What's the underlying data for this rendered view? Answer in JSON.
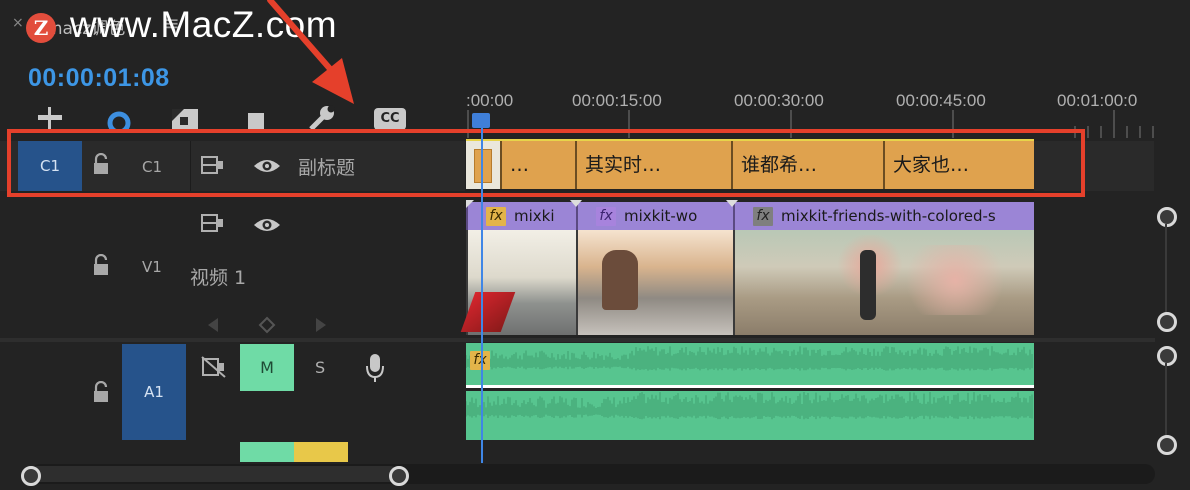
{
  "header": {
    "close_glyph": "×",
    "tab_title": "macz调色",
    "menu_glyph": "≡",
    "logo_letter": "Z",
    "watermark": "www.MacZ.com",
    "timecode": "00:00:01:08"
  },
  "toolbar": {
    "icons": [
      "snap-icon",
      "linked-selection-icon",
      "marker-icon",
      "add-marker-icon",
      "wrench-icon",
      "captions-icon"
    ],
    "captions_label": "CC"
  },
  "ruler": {
    "labels": [
      ":00:00",
      "00:00:15:00",
      "00:00:30:00",
      "00:00:45:00",
      "00:01:00:0"
    ]
  },
  "tracks": {
    "c1": {
      "source": "C1",
      "label": "C1",
      "name": "副标题"
    },
    "v1": {
      "label": "V1",
      "name": "视频 1"
    },
    "a1": {
      "source": "A1",
      "mute": "M",
      "solo": "S"
    }
  },
  "caption_clips": [
    "…",
    "其实时…",
    "谁都希…",
    "大家也…"
  ],
  "video_clips": [
    {
      "name": "mixki",
      "fx": "fx"
    },
    {
      "name": "mixkit-wo",
      "fx": "fx"
    },
    {
      "name": "mixkit-friends-with-colored-s",
      "fx": "fx"
    }
  ],
  "audio_clip": {
    "fx": "fx"
  },
  "colors": {
    "caption_clip": "#dfa24e",
    "video_clip": "#9b85d6",
    "audio_clip": "#57c58f",
    "timecode": "#3d96e5",
    "highlight": "#e5402b"
  }
}
